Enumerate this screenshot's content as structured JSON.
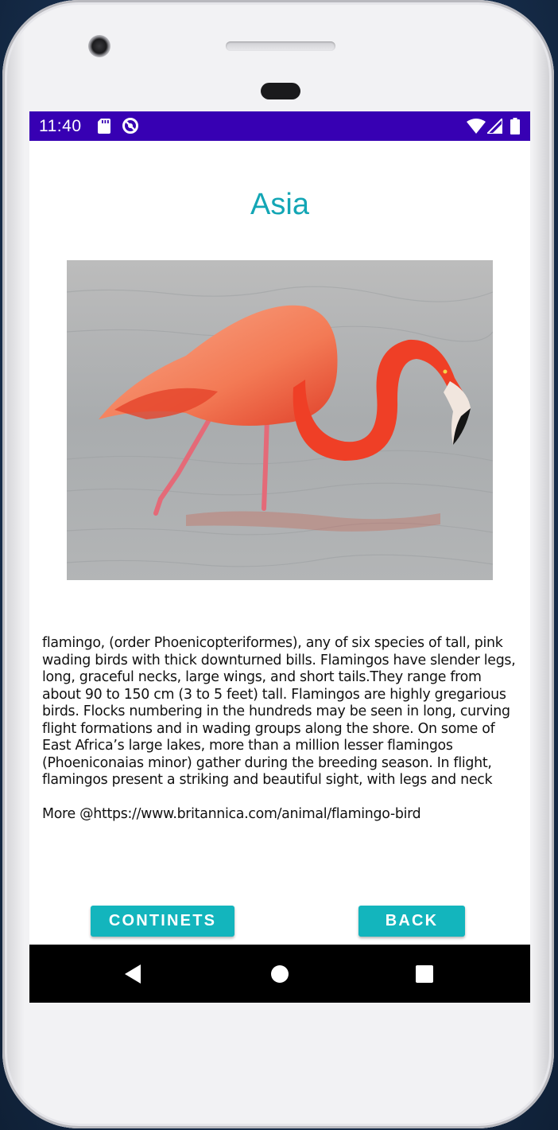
{
  "status_bar": {
    "time": "11:40",
    "left_icons": [
      "sd-card-icon",
      "data-saver-icon"
    ],
    "right_icons": [
      "wifi-icon",
      "signal-icon",
      "battery-icon"
    ],
    "color": "#3700b3"
  },
  "page": {
    "title": "Asia",
    "title_color": "#13a6b5",
    "image": "flamingo-photo",
    "description": "flamingo, (order Phoenicopteriformes), any of six species of tall, pink wading birds with thick downturned bills. Flamingos have slender legs, long, graceful necks, large wings, and short tails.They range from about 90 to 150 cm (3 to 5 feet) tall. Flamingos are highly gregarious birds. Flocks numbering in the hundreds may be seen in long, curving flight formations and in wading groups along the shore. On some of East Africa’s large lakes, more than a million lesser flamingos (Phoeniconaias minor) gather during the breeding season. In flight, flamingos present a striking and beautiful sight, with legs and neck",
    "more_link": "More @https://www.britannica.com/animal/flamingo-bird"
  },
  "buttons": {
    "continents_label": "CONTINETS",
    "back_label": "BACK",
    "color": "#13b5bd"
  },
  "nav_bar": {
    "icons": [
      "back-triangle-icon",
      "home-circle-icon",
      "recents-square-icon"
    ]
  }
}
